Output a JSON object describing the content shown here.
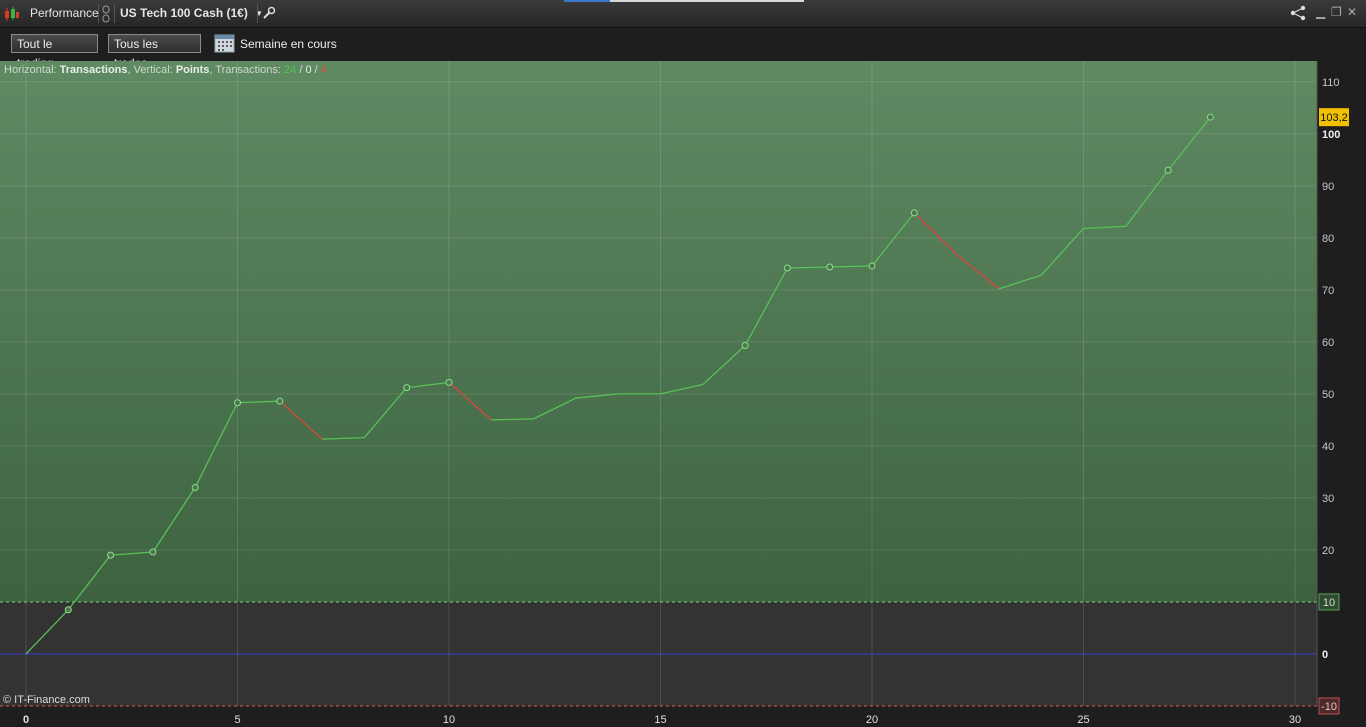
{
  "window": {
    "title": "Performance",
    "instrument": "US Tech 100 Cash (1€)",
    "controls": [
      "share-icon",
      "minimize-icon",
      "restore-icon",
      "close-icon"
    ]
  },
  "toolbar": {
    "filter_trading": "Tout le trading",
    "filter_trades": "Tous les trades",
    "period": "Semaine en cours"
  },
  "info": {
    "h_label": "Horizontal:",
    "h_value": "Transactions",
    "v_label": ", Vertical:",
    "v_value": "Points",
    "t_label": ", Transactions:",
    "t_win": "24",
    "slash1": " / ",
    "t_even": "0",
    "slash2": " / ",
    "t_loss": "4"
  },
  "copyright": "© IT-Finance.com",
  "colors": {
    "gain_line": "#57c157",
    "loss_line": "#d9483b",
    "zero_line": "#3e3ecf",
    "last_value_badge": "#f2c200"
  },
  "chart_data": {
    "type": "line",
    "xlabel": "Transactions",
    "ylabel": "Points",
    "xlim": [
      0,
      30
    ],
    "ylim": [
      -10,
      114
    ],
    "x_ticks": [
      0,
      5,
      10,
      15,
      20,
      25,
      30
    ],
    "y_ticks": [
      110,
      100,
      90,
      80,
      70,
      60,
      50,
      40,
      30,
      20,
      0
    ],
    "bands": [
      10,
      -10
    ],
    "zero": 0,
    "last_value_label": "103,2",
    "series": [
      {
        "x": [
          0,
          1,
          2,
          3,
          4,
          5,
          6,
          7,
          8,
          9,
          10,
          11,
          12,
          13,
          14,
          15,
          16,
          17,
          18,
          19,
          20,
          21,
          22,
          23,
          24,
          25,
          26,
          27,
          28
        ],
        "y": [
          0,
          8.5,
          19,
          19.6,
          32,
          48.3,
          48.6,
          41.3,
          41.6,
          51.2,
          52.2,
          45,
          45.2,
          49.2,
          50,
          50,
          51.8,
          59.3,
          74.2,
          74.4,
          74.6,
          84.8,
          76.8,
          70.2,
          72.8,
          81.8,
          82.2,
          93,
          103.2
        ],
        "markers": [
          false,
          true,
          true,
          true,
          true,
          true,
          true,
          false,
          false,
          true,
          true,
          false,
          false,
          false,
          false,
          false,
          false,
          true,
          true,
          true,
          true,
          true,
          false,
          false,
          false,
          false,
          false,
          true,
          true
        ]
      }
    ]
  }
}
